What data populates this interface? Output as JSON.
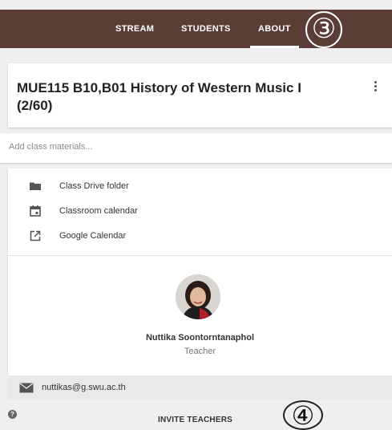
{
  "nav": {
    "tabs": [
      {
        "label": "STREAM"
      },
      {
        "label": "STUDENTS"
      },
      {
        "label": "ABOUT"
      }
    ],
    "active_tab": "ABOUT"
  },
  "annotations": {
    "marker_top": "③",
    "marker_bottom": "④"
  },
  "class": {
    "title": "MUE115 B10,B01 History of Western Music I (2/60)"
  },
  "materials": {
    "placeholder": "Add class materials..."
  },
  "links": [
    {
      "label": "Class Drive folder",
      "icon": "folder-icon"
    },
    {
      "label": "Classroom calendar",
      "icon": "calendar-icon"
    },
    {
      "label": "Google Calendar",
      "icon": "external-link-icon"
    }
  ],
  "teacher": {
    "name": "Nuttika Soontorntanaphol",
    "role": "Teacher",
    "email": "nuttikas@g.swu.ac.th"
  },
  "footer": {
    "invite_label": "INVITE TEACHERS"
  },
  "colors": {
    "header_bg": "#5a3e36",
    "card_bg": "#ffffff",
    "page_bg": "#efefef"
  }
}
